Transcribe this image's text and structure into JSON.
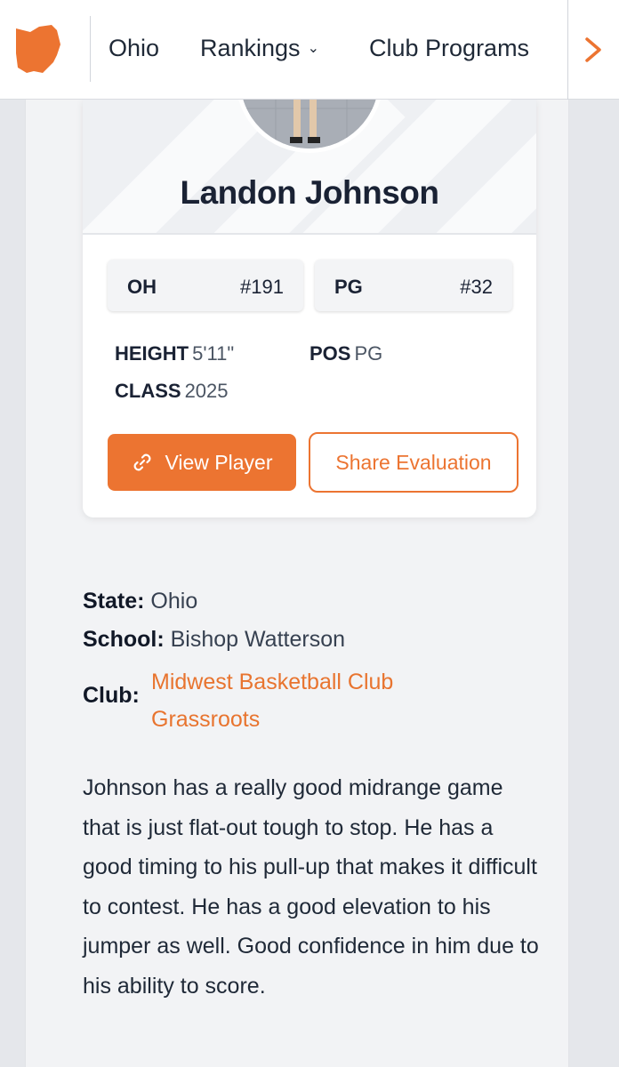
{
  "nav": {
    "items": [
      "Ohio",
      "Rankings",
      "Club Programs"
    ],
    "logo_icon": "ohio-state-shape-icon",
    "next_icon": "chevron-right-icon",
    "accent": "#ec7431"
  },
  "player": {
    "name": "Landon Johnson",
    "rankings": [
      {
        "label": "OH",
        "value": "#191"
      },
      {
        "label": "PG",
        "value": "#32"
      }
    ],
    "height_label": "HEIGHT",
    "height": "5'11\"",
    "pos_label": "POS",
    "pos": "PG",
    "class_label": "CLASS",
    "class": "2025"
  },
  "buttons": {
    "view_player": "View Player",
    "share": "Share Evaluation"
  },
  "info": {
    "state_label": "State:",
    "state": "Ohio",
    "school_label": "School:",
    "school": "Bishop Watterson",
    "club_label": "Club:",
    "club": "Midwest Basketball Club Grassroots"
  },
  "evaluation": "Johnson has a really good midrange game that is just flat-out tough to stop. He has a good timing to his pull-up that makes it difficult to contest. He has a good elevation to his jumper as well. Good confidence in him due to his ability to score."
}
